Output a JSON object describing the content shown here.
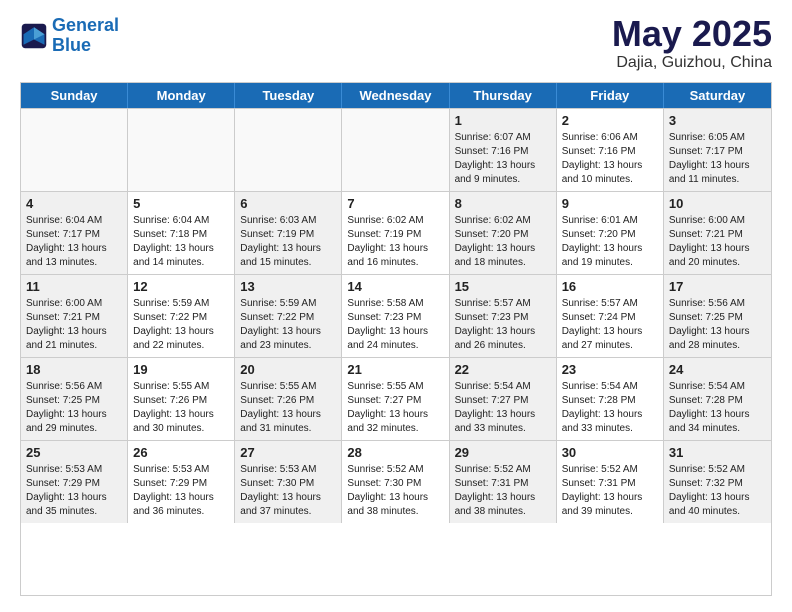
{
  "header": {
    "logo_line1": "General",
    "logo_line2": "Blue",
    "month_title": "May 2025",
    "location": "Dajia, Guizhou, China"
  },
  "days": [
    "Sunday",
    "Monday",
    "Tuesday",
    "Wednesday",
    "Thursday",
    "Friday",
    "Saturday"
  ],
  "rows": [
    [
      {
        "day": "",
        "info": "",
        "empty": true
      },
      {
        "day": "",
        "info": "",
        "empty": true
      },
      {
        "day": "",
        "info": "",
        "empty": true
      },
      {
        "day": "",
        "info": "",
        "empty": true
      },
      {
        "day": "1",
        "info": "Sunrise: 6:07 AM\nSunset: 7:16 PM\nDaylight: 13 hours\nand 9 minutes."
      },
      {
        "day": "2",
        "info": "Sunrise: 6:06 AM\nSunset: 7:16 PM\nDaylight: 13 hours\nand 10 minutes."
      },
      {
        "day": "3",
        "info": "Sunrise: 6:05 AM\nSunset: 7:17 PM\nDaylight: 13 hours\nand 11 minutes."
      }
    ],
    [
      {
        "day": "4",
        "info": "Sunrise: 6:04 AM\nSunset: 7:17 PM\nDaylight: 13 hours\nand 13 minutes."
      },
      {
        "day": "5",
        "info": "Sunrise: 6:04 AM\nSunset: 7:18 PM\nDaylight: 13 hours\nand 14 minutes."
      },
      {
        "day": "6",
        "info": "Sunrise: 6:03 AM\nSunset: 7:19 PM\nDaylight: 13 hours\nand 15 minutes."
      },
      {
        "day": "7",
        "info": "Sunrise: 6:02 AM\nSunset: 7:19 PM\nDaylight: 13 hours\nand 16 minutes."
      },
      {
        "day": "8",
        "info": "Sunrise: 6:02 AM\nSunset: 7:20 PM\nDaylight: 13 hours\nand 18 minutes."
      },
      {
        "day": "9",
        "info": "Sunrise: 6:01 AM\nSunset: 7:20 PM\nDaylight: 13 hours\nand 19 minutes."
      },
      {
        "day": "10",
        "info": "Sunrise: 6:00 AM\nSunset: 7:21 PM\nDaylight: 13 hours\nand 20 minutes."
      }
    ],
    [
      {
        "day": "11",
        "info": "Sunrise: 6:00 AM\nSunset: 7:21 PM\nDaylight: 13 hours\nand 21 minutes."
      },
      {
        "day": "12",
        "info": "Sunrise: 5:59 AM\nSunset: 7:22 PM\nDaylight: 13 hours\nand 22 minutes."
      },
      {
        "day": "13",
        "info": "Sunrise: 5:59 AM\nSunset: 7:22 PM\nDaylight: 13 hours\nand 23 minutes."
      },
      {
        "day": "14",
        "info": "Sunrise: 5:58 AM\nSunset: 7:23 PM\nDaylight: 13 hours\nand 24 minutes."
      },
      {
        "day": "15",
        "info": "Sunrise: 5:57 AM\nSunset: 7:23 PM\nDaylight: 13 hours\nand 26 minutes."
      },
      {
        "day": "16",
        "info": "Sunrise: 5:57 AM\nSunset: 7:24 PM\nDaylight: 13 hours\nand 27 minutes."
      },
      {
        "day": "17",
        "info": "Sunrise: 5:56 AM\nSunset: 7:25 PM\nDaylight: 13 hours\nand 28 minutes."
      }
    ],
    [
      {
        "day": "18",
        "info": "Sunrise: 5:56 AM\nSunset: 7:25 PM\nDaylight: 13 hours\nand 29 minutes."
      },
      {
        "day": "19",
        "info": "Sunrise: 5:55 AM\nSunset: 7:26 PM\nDaylight: 13 hours\nand 30 minutes."
      },
      {
        "day": "20",
        "info": "Sunrise: 5:55 AM\nSunset: 7:26 PM\nDaylight: 13 hours\nand 31 minutes."
      },
      {
        "day": "21",
        "info": "Sunrise: 5:55 AM\nSunset: 7:27 PM\nDaylight: 13 hours\nand 32 minutes."
      },
      {
        "day": "22",
        "info": "Sunrise: 5:54 AM\nSunset: 7:27 PM\nDaylight: 13 hours\nand 33 minutes."
      },
      {
        "day": "23",
        "info": "Sunrise: 5:54 AM\nSunset: 7:28 PM\nDaylight: 13 hours\nand 33 minutes."
      },
      {
        "day": "24",
        "info": "Sunrise: 5:54 AM\nSunset: 7:28 PM\nDaylight: 13 hours\nand 34 minutes."
      }
    ],
    [
      {
        "day": "25",
        "info": "Sunrise: 5:53 AM\nSunset: 7:29 PM\nDaylight: 13 hours\nand 35 minutes."
      },
      {
        "day": "26",
        "info": "Sunrise: 5:53 AM\nSunset: 7:29 PM\nDaylight: 13 hours\nand 36 minutes."
      },
      {
        "day": "27",
        "info": "Sunrise: 5:53 AM\nSunset: 7:30 PM\nDaylight: 13 hours\nand 37 minutes."
      },
      {
        "day": "28",
        "info": "Sunrise: 5:52 AM\nSunset: 7:30 PM\nDaylight: 13 hours\nand 38 minutes."
      },
      {
        "day": "29",
        "info": "Sunrise: 5:52 AM\nSunset: 7:31 PM\nDaylight: 13 hours\nand 38 minutes."
      },
      {
        "day": "30",
        "info": "Sunrise: 5:52 AM\nSunset: 7:31 PM\nDaylight: 13 hours\nand 39 minutes."
      },
      {
        "day": "31",
        "info": "Sunrise: 5:52 AM\nSunset: 7:32 PM\nDaylight: 13 hours\nand 40 minutes."
      }
    ]
  ]
}
